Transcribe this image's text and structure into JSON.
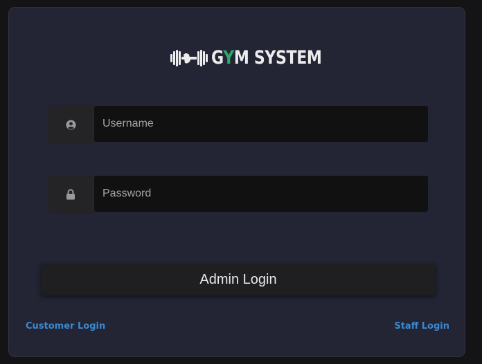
{
  "logo": {
    "text_before": "G",
    "text_highlight": "Y",
    "text_after": "M SYSTEM",
    "icon": "dumbbell-icon",
    "highlight_color": "#2fa96a"
  },
  "form": {
    "username": {
      "placeholder": "Username",
      "value": "",
      "icon": "user-circle-icon"
    },
    "password": {
      "placeholder": "Password",
      "value": "",
      "icon": "lock-icon"
    },
    "submit_label": "Admin Login"
  },
  "links": {
    "customer": "Customer Login",
    "staff": "Staff Login",
    "color": "#3a8ad0"
  }
}
